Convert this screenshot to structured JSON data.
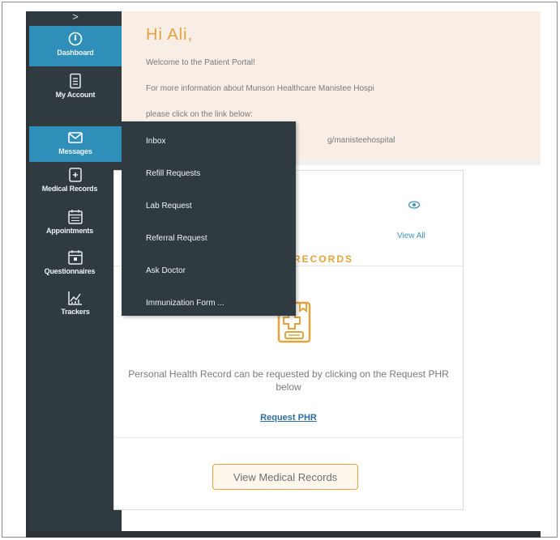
{
  "sidebar": {
    "toggle": ">",
    "items": [
      {
        "label": "Dashboard",
        "icon": "dashboard-icon"
      },
      {
        "label": "My Account",
        "icon": "account-icon"
      },
      {
        "label": "Messages",
        "icon": "envelope-icon"
      },
      {
        "label": "Medical Records",
        "icon": "medical-records-icon"
      },
      {
        "label": "Appointments",
        "icon": "calendar-icon"
      },
      {
        "label": "Questionnaires",
        "icon": "questionnaire-icon"
      },
      {
        "label": "Trackers",
        "icon": "chart-icon"
      }
    ]
  },
  "welcome": {
    "greeting": "Hi Ali,",
    "line1": "Welcome to the Patient Portal!",
    "line2": "For more information about Munson Healthcare Manistee Hospi",
    "line3": "please click on the link below:",
    "line4": "g/manisteehospital"
  },
  "messages_menu": {
    "items": [
      "Inbox",
      "Refill Requests",
      "Lab Request",
      "Referral Request",
      "Ask Doctor",
      "Immunization Form ..."
    ]
  },
  "card": {
    "section_label": "RECORDS",
    "view_all": "View All",
    "description": "Personal Health Record can be requested by clicking on the Request PHR below",
    "request_link": "Request PHR",
    "button": "View Medical Records"
  },
  "colors": {
    "sidebar": "#2f3b41",
    "active": "#2f8fb8",
    "accent": "#e4a33a",
    "welcome_bg": "#f8eee6"
  }
}
